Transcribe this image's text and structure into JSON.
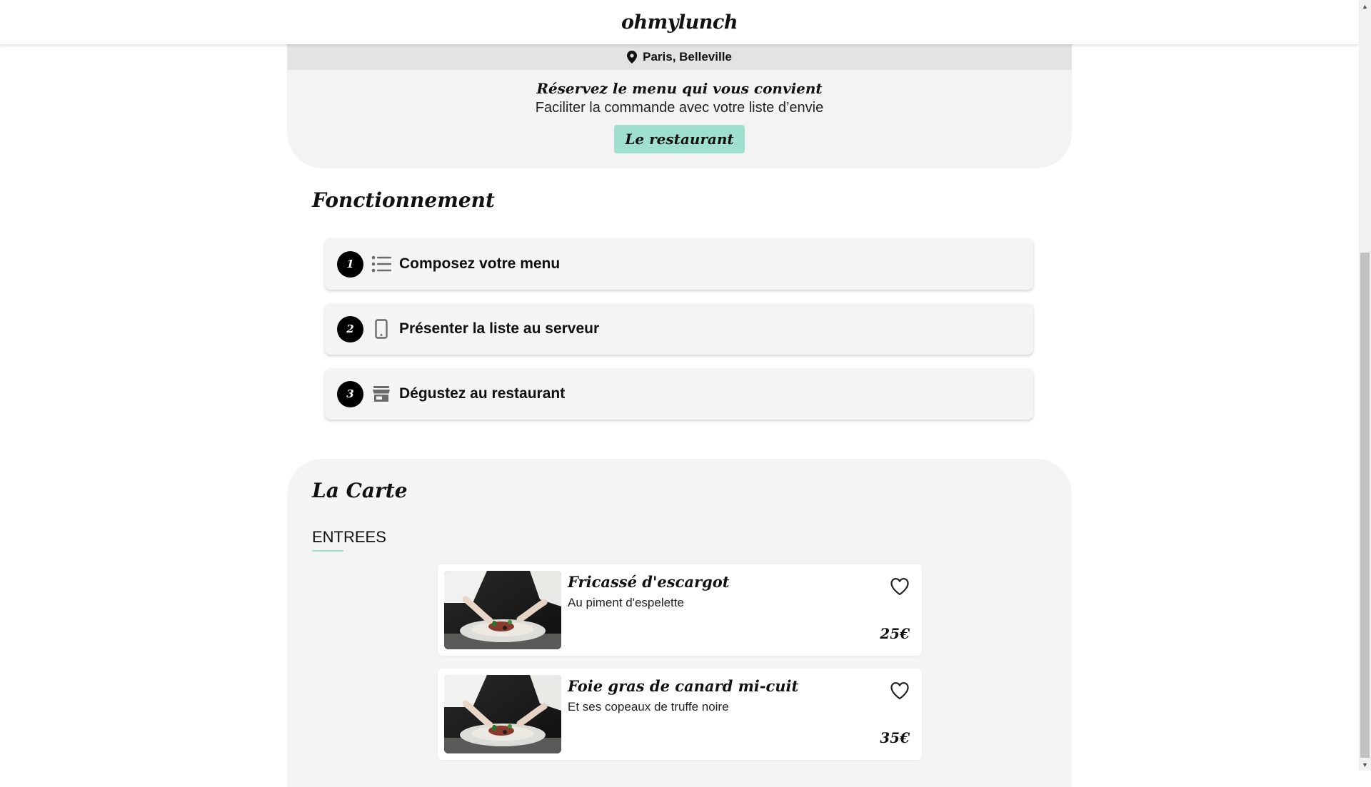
{
  "header": {
    "brand": "ohmylunch"
  },
  "location": {
    "label": "Paris, Belleville",
    "icon": "map-pin-icon"
  },
  "hero": {
    "title": "Réservez le menu qui vous convient",
    "subtitle": "Faciliter la commande avec votre liste d’envie",
    "button_label": "Le restaurant",
    "button_color": "#9ee0cd"
  },
  "how_it_works": {
    "title": "Fonctionnement",
    "steps": [
      {
        "number": "1",
        "icon": "list-icon",
        "label": "Composez votre menu"
      },
      {
        "number": "2",
        "icon": "phone-icon",
        "label": "Présenter la liste au serveur"
      },
      {
        "number": "3",
        "icon": "store-icon",
        "label": "Dégustez au restaurant"
      }
    ]
  },
  "menu": {
    "title": "La Carte",
    "category": "ENTREES",
    "dishes": [
      {
        "name": "Fricassé d'escargot",
        "description": "Au piment d'espelette",
        "price": "25€"
      },
      {
        "name": "Foie gras de canard mi-cuit",
        "description": "Et ses copeaux de truffe noire",
        "price": "35€"
      }
    ]
  }
}
